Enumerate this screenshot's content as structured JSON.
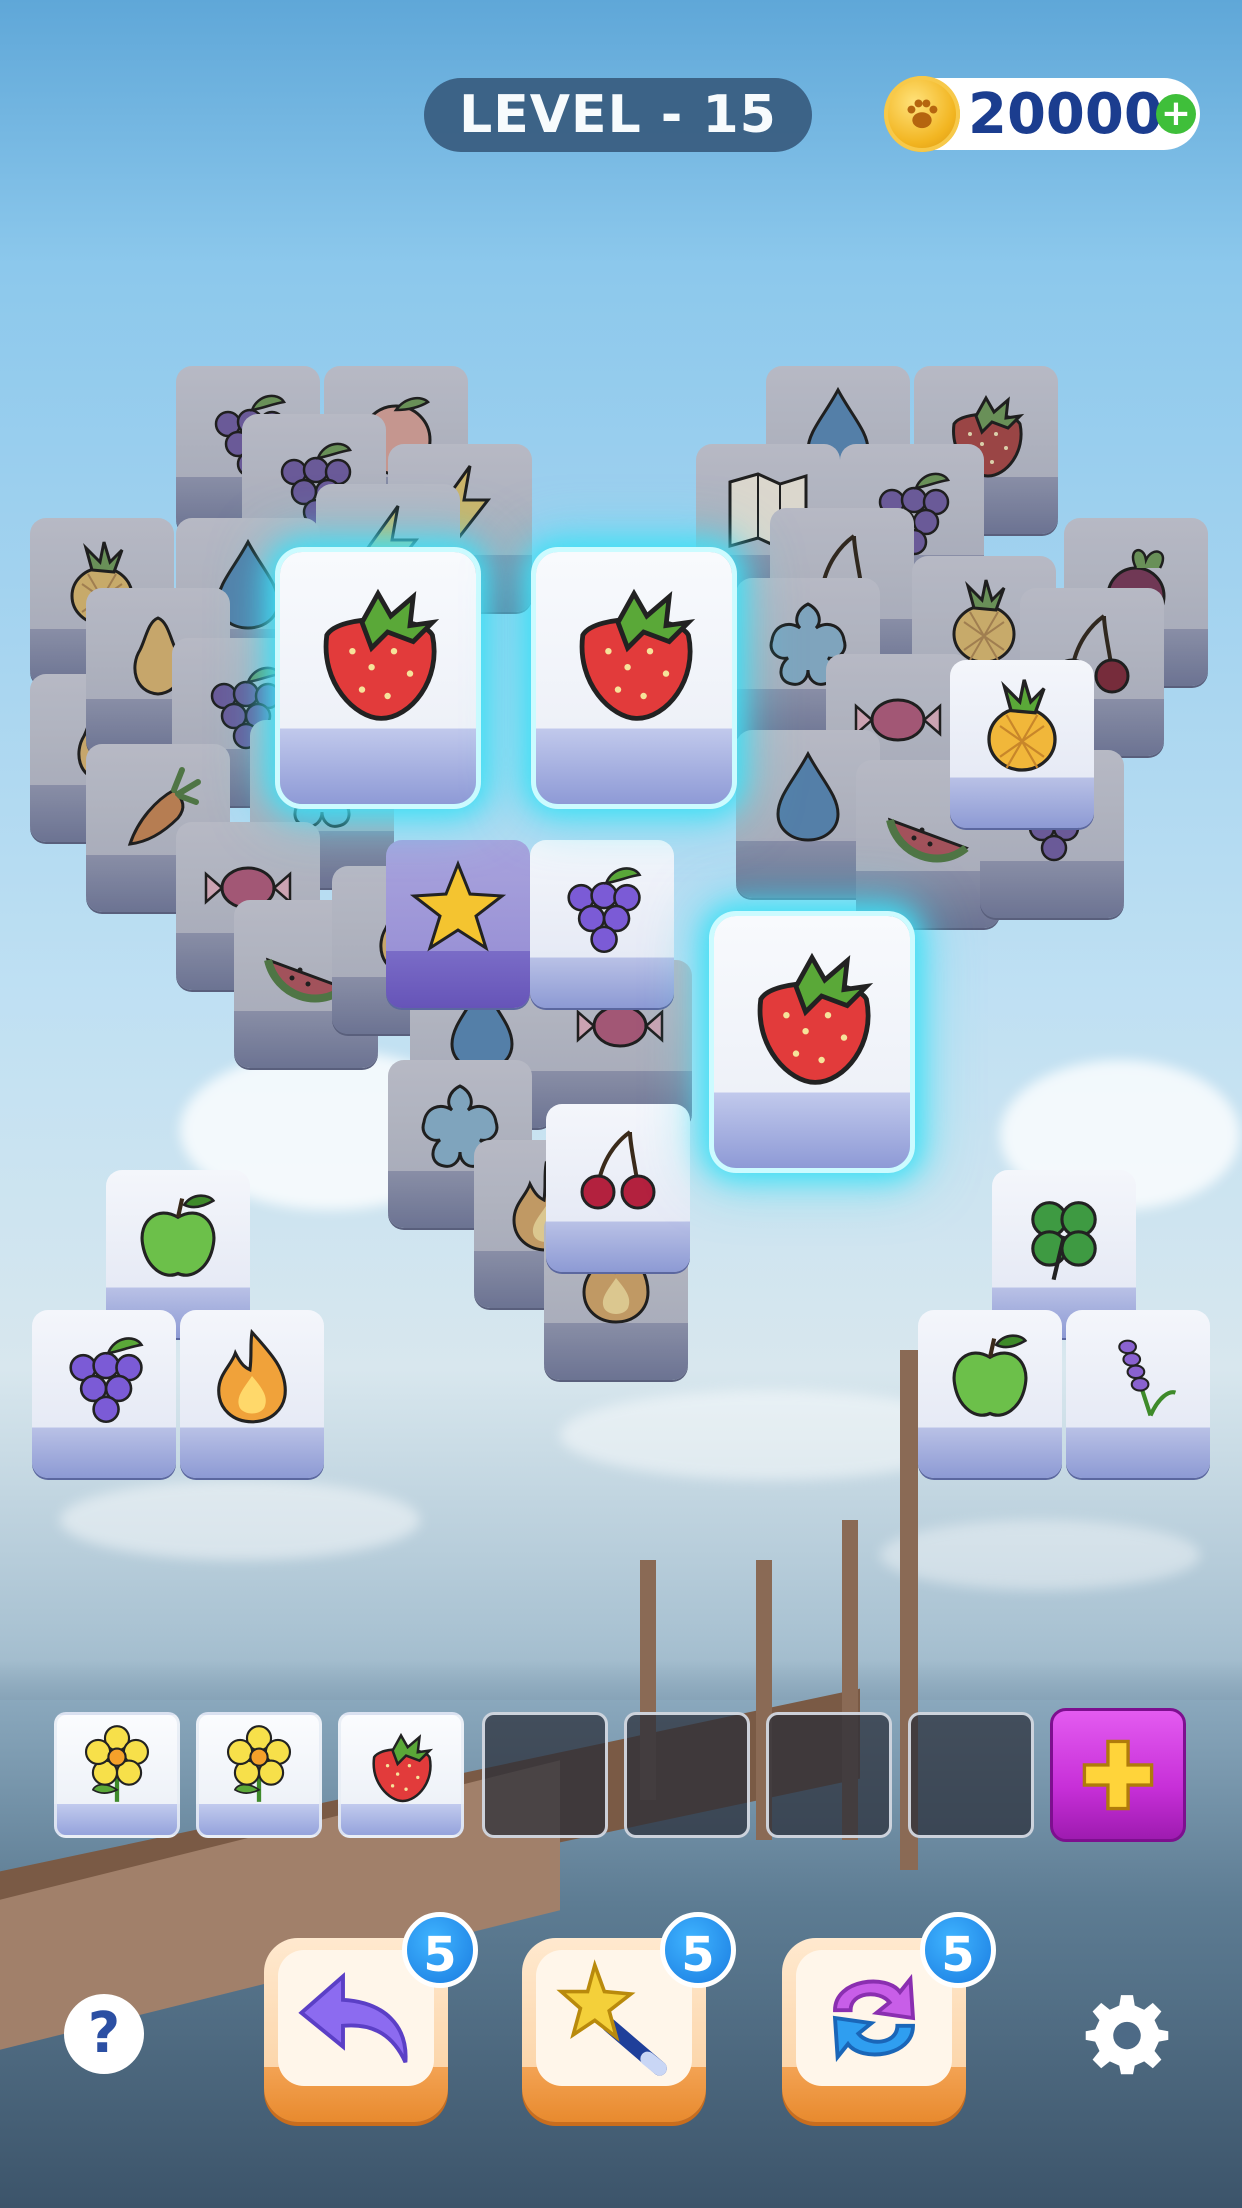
{
  "header": {
    "level_label": "LEVEL - 15",
    "coins": "20000",
    "coin_icon": "paw-coin-icon",
    "add_coins_icon": "plus-icon"
  },
  "board": {
    "highlighted_tiles": [
      "strawberry",
      "strawberry",
      "strawberry"
    ],
    "visible_tiles": [
      "grape",
      "peach",
      "grape",
      "lightning",
      "water-drop",
      "strawberry",
      "map",
      "grape",
      "pineapple",
      "flame",
      "cherry",
      "pineapple",
      "beet",
      "strawberry",
      "strawberry",
      "snowflake",
      "pear",
      "cherry",
      "grape",
      "candy",
      "pineapple",
      "carrot",
      "water-drop",
      "star",
      "grape",
      "watermelon",
      "strawberry",
      "apple",
      "cherry",
      "grape",
      "flame",
      "clover",
      "apple",
      "lavender"
    ]
  },
  "tray": {
    "slots": [
      "flower",
      "flower",
      "strawberry",
      "",
      "",
      "",
      "",
      ""
    ],
    "add_slot_icon": "plus-icon"
  },
  "boosters": [
    {
      "name": "undo",
      "icon": "undo-arrow-icon",
      "count": "5"
    },
    {
      "name": "magic-wand",
      "icon": "magic-wand-icon",
      "count": "5"
    },
    {
      "name": "shuffle",
      "icon": "shuffle-icon",
      "count": "5"
    }
  ],
  "controls": {
    "help_label": "?",
    "settings_icon": "gear-icon"
  },
  "colors": {
    "tile_glow": "#3fe0f5",
    "level_pill": "#3a5f83",
    "coin_text": "#1b3d8f",
    "tray_add": "#c72fd8",
    "booster_badge": "#1a7be0"
  }
}
